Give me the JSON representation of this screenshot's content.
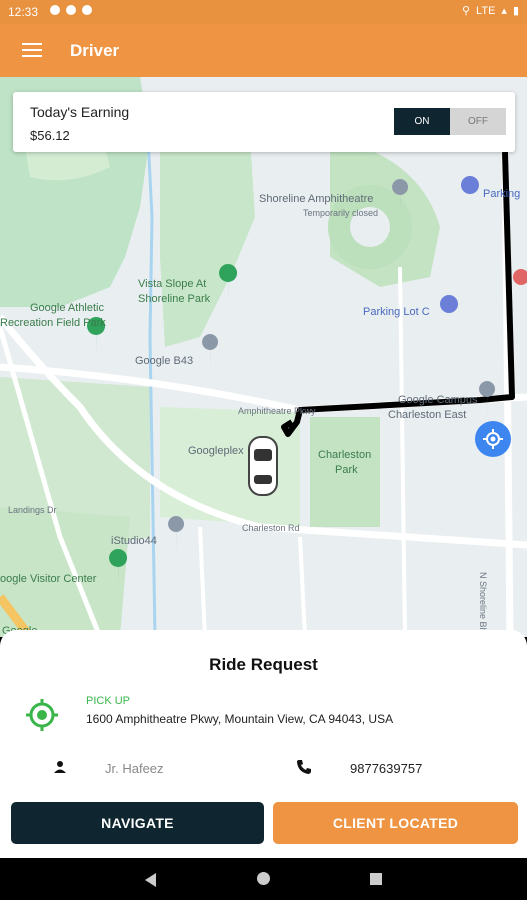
{
  "status_bar": {
    "time": "12:33",
    "network": "LTE"
  },
  "app_bar": {
    "title": "Driver",
    "menu_icon": "hamburger-menu-icon"
  },
  "earnings": {
    "label": "Today's Earning",
    "amount": "$56.12",
    "toggle_on": "ON",
    "toggle_off": "OFF",
    "toggle_state": "ON"
  },
  "map": {
    "labels": {
      "shoreline": "Shoreline Amphitheatre",
      "temporarily_closed": "Temporarily closed",
      "parking": "Parking",
      "vista_1": "Vista Slope At",
      "vista_2": "Shoreline Park",
      "athletic_1": "Google Athletic",
      "athletic_2": "Recreation Field Park",
      "parking_lot_c": "Parking Lot C",
      "google_b43": "Google B43",
      "amphitheatre_road": "Amphitheatre Pkwy",
      "google_campus_1": "Google Campus",
      "google_campus_2": "Charleston East",
      "googleplex": "Googleplex",
      "charleston_1": "Charleston",
      "charleston_2": "Park",
      "landings": "Landings Dr",
      "charleston_rd": "Charleston Rd",
      "istudio": "iStudio44",
      "visitor_center": "oogle Visitor Center",
      "shoreline_blvd": "N Shoreline Blvd",
      "google_bottom": "Google"
    }
  },
  "ride_request": {
    "title": "Ride Request",
    "pickup_label": "PICK UP",
    "pickup_address": "1600 Amphitheatre Pkwy, Mountain View, CA 94043, USA",
    "rider_name": "Jr. Hafeez",
    "phone": "9877639757",
    "navigate_label": "NAVIGATE",
    "client_located_label": "CLIENT LOCATED"
  },
  "colors": {
    "accent": "#ef9442",
    "dark": "#0f2530",
    "pickup_green": "#39b54a",
    "location_blue": "#3d86f0"
  }
}
